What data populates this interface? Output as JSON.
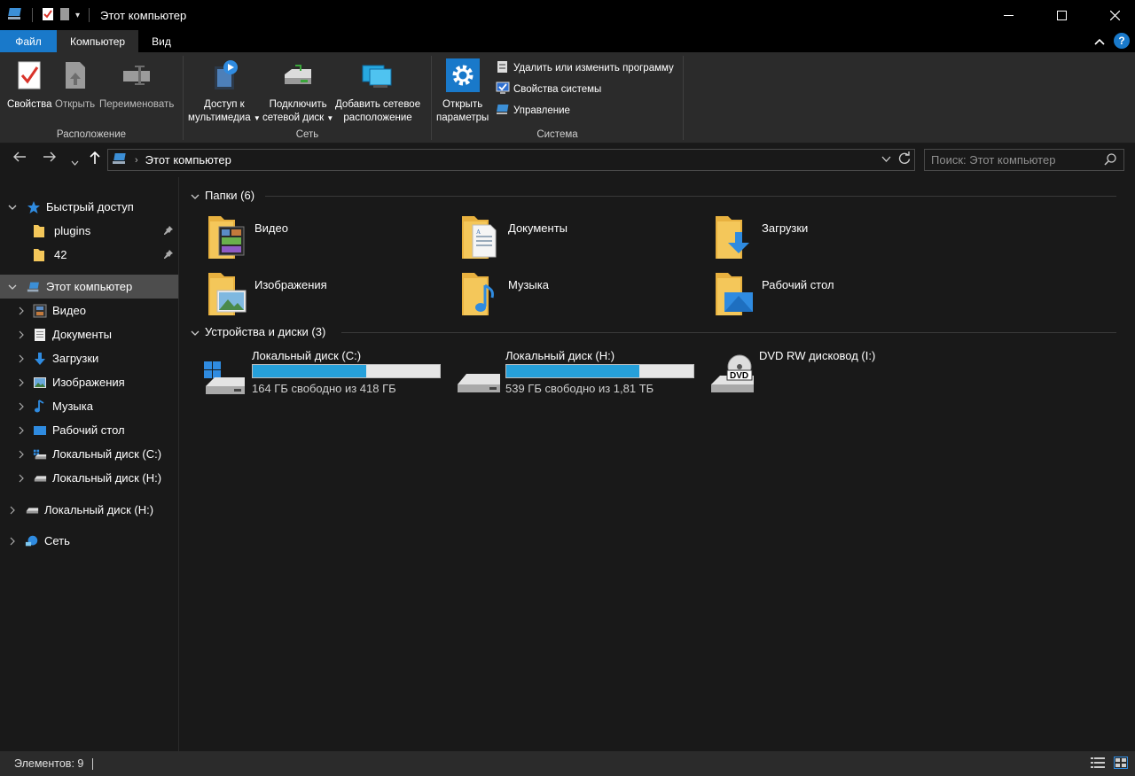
{
  "window": {
    "title": "Этот компьютер",
    "controls": [
      "minimize",
      "maximize",
      "close"
    ]
  },
  "ribbon": {
    "tabs": [
      {
        "label": "Файл"
      },
      {
        "label": "Компьютер"
      },
      {
        "label": "Вид"
      }
    ],
    "help": "?",
    "groups": {
      "location": {
        "label": "Расположение",
        "buttons": [
          {
            "label": "Свойства",
            "icon": "properties-icon"
          },
          {
            "label": "Открыть",
            "icon": "open-icon"
          },
          {
            "label": "Переименовать",
            "icon": "rename-icon"
          }
        ]
      },
      "network": {
        "label": "Сеть",
        "buttons": [
          {
            "line1": "Доступ к",
            "line2": "мультимедиа",
            "icon": "media-access-icon"
          },
          {
            "line1": "Подключить",
            "line2": "сетевой диск",
            "icon": "map-drive-icon"
          },
          {
            "line1": "Добавить сетевое",
            "line2": "расположение",
            "icon": "add-network-location-icon"
          }
        ]
      },
      "system": {
        "label": "Система",
        "open_settings": {
          "line1": "Открыть",
          "line2": "параметры"
        },
        "items": [
          {
            "label": "Удалить или изменить программу",
            "icon": "uninstall-icon"
          },
          {
            "label": "Свойства системы",
            "icon": "system-properties-icon"
          },
          {
            "label": "Управление",
            "icon": "manage-icon"
          }
        ]
      }
    }
  },
  "address": {
    "path": "Этот компьютер",
    "search_placeholder": "Поиск: Этот компьютер"
  },
  "sidebar": {
    "quick_access": "Быстрый доступ",
    "pinned": [
      {
        "label": "plugins"
      },
      {
        "label": "42"
      }
    ],
    "this_pc": "Этот компьютер",
    "pc_children": [
      {
        "label": "Видео",
        "icon": "video-folder-icon"
      },
      {
        "label": "Документы",
        "icon": "documents-folder-icon"
      },
      {
        "label": "Загрузки",
        "icon": "downloads-folder-icon"
      },
      {
        "label": "Изображения",
        "icon": "pictures-folder-icon"
      },
      {
        "label": "Музыка",
        "icon": "music-folder-icon"
      },
      {
        "label": "Рабочий стол",
        "icon": "desktop-folder-icon"
      },
      {
        "label": "Локальный диск (C:)",
        "icon": "drive-c-icon"
      },
      {
        "label": "Локальный диск (H:)",
        "icon": "drive-h-icon"
      }
    ],
    "extra_drive": "Локальный диск (H:)",
    "network": "Сеть"
  },
  "content": {
    "folders_header": "Папки (6)",
    "folders": [
      {
        "name": "Видео",
        "icon": "video-folder-icon"
      },
      {
        "name": "Документы",
        "icon": "documents-folder-icon"
      },
      {
        "name": "Загрузки",
        "icon": "downloads-folder-icon"
      },
      {
        "name": "Изображения",
        "icon": "pictures-folder-icon"
      },
      {
        "name": "Музыка",
        "icon": "music-folder-icon"
      },
      {
        "name": "Рабочий стол",
        "icon": "desktop-folder-icon"
      }
    ],
    "drives_header": "Устройства и диски (3)",
    "drives": [
      {
        "name": "Локальный диск (C:)",
        "free_text": "164 ГБ свободно из 418 ГБ",
        "used_fraction": 0.608
      },
      {
        "name": "Локальный диск (H:)",
        "free_text": "539 ГБ свободно из 1,81 ТБ",
        "used_fraction": 0.709
      },
      {
        "name": "DVD RW дисковод (I:)",
        "dvd_label": "DVD"
      }
    ]
  },
  "status": {
    "items": "Элементов: 9"
  },
  "colors": {
    "accent": "#1979ca",
    "bar_fill": "#26a0da",
    "folder": "#f4c75a"
  }
}
